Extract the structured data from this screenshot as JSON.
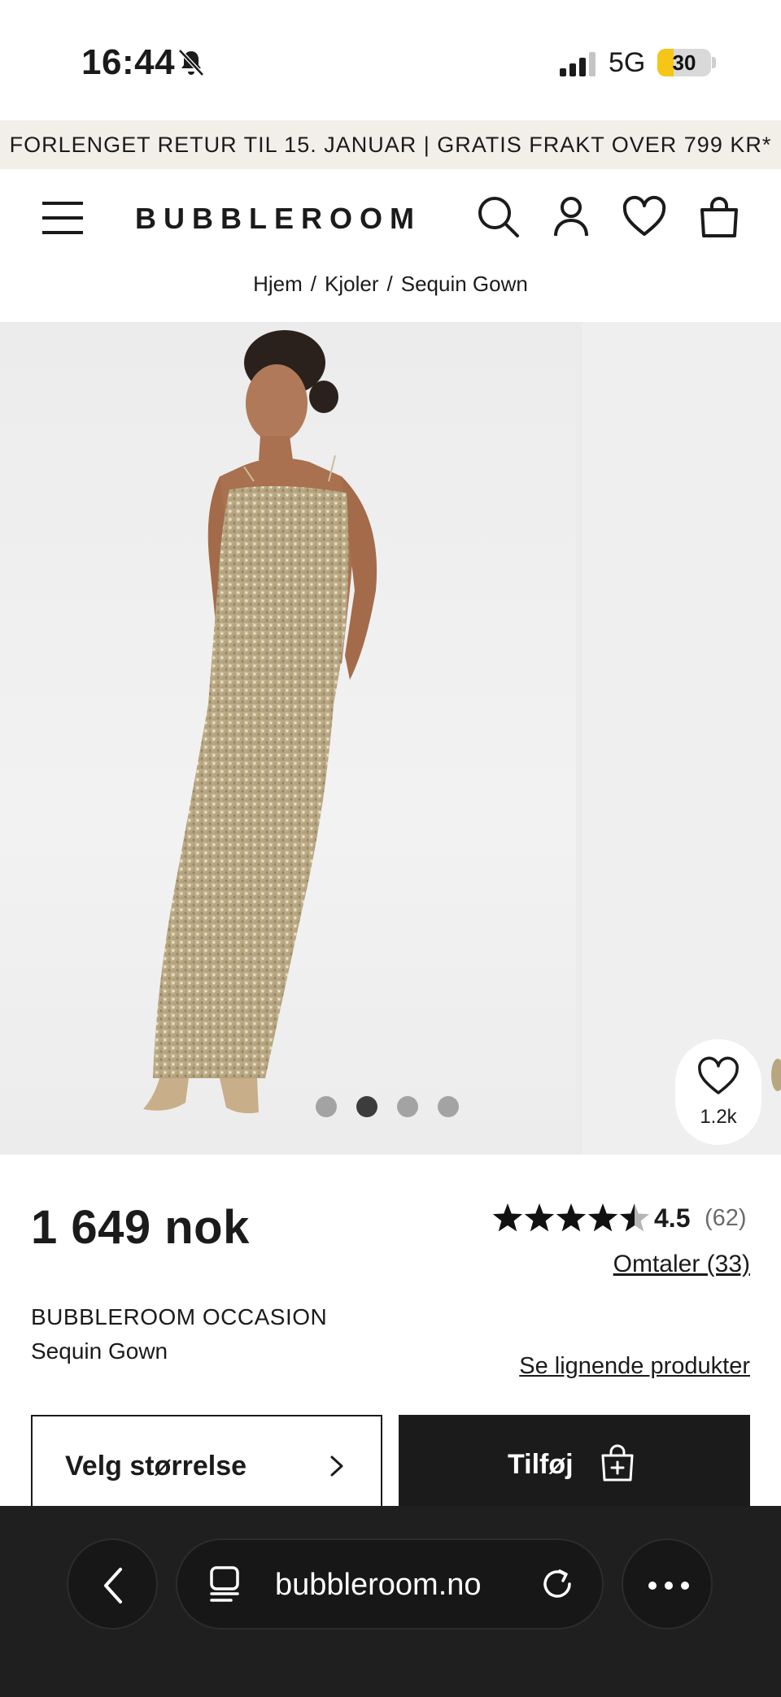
{
  "status_bar": {
    "time": "16:44",
    "network": "5G",
    "battery_level": "30",
    "battery_fraction": 0.3
  },
  "promo": {
    "text": "FORLENGET RETUR TIL 15. JANUAR | GRATIS FRAKT OVER 799 KR*"
  },
  "header": {
    "logo": "BUBBLEROOM",
    "icons": [
      "menu-icon",
      "search-icon",
      "account-icon",
      "heart-icon",
      "bag-icon"
    ]
  },
  "breadcrumb": {
    "items": [
      "Hjem",
      "Kjoler",
      "Sequin Gown"
    ],
    "separator": "/"
  },
  "gallery": {
    "slide_count": 4,
    "active_slide": 2,
    "favorites_count": "1.2k"
  },
  "product": {
    "price": "1 649 nok",
    "rating": "4.5",
    "rating_value": 4.5,
    "rating_count": "(62)",
    "reviews_link": "Omtaler (33)",
    "brand": "BUBBLEROOM OCCASION",
    "name": "Sequin Gown",
    "similar_link": "Se lignende produkter"
  },
  "actions": {
    "size_label": "Velg størrelse",
    "add_label": "Tilføj"
  },
  "browser": {
    "url": "bubbleroom.no"
  },
  "colors": {
    "text": "#1b1b1b",
    "promo_bg": "#f2efe9",
    "battery": "#f5c518",
    "browser_bg": "#1f1f1f",
    "dot_active": "#3c3c3c",
    "dot_inactive": "#a3a3a3"
  }
}
